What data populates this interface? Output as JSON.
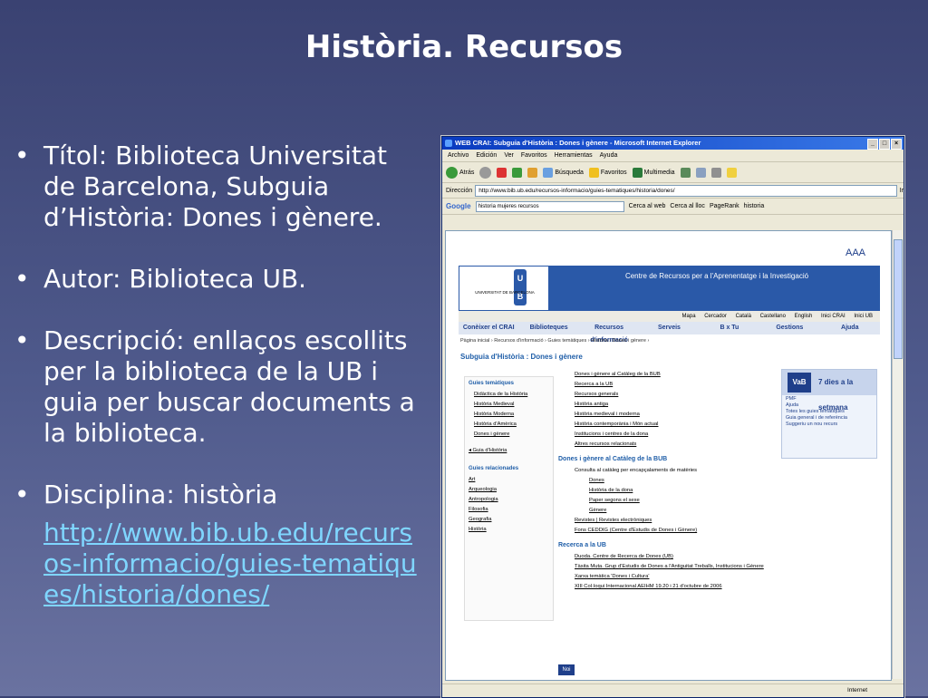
{
  "slide": {
    "title": "Història. Recursos",
    "bullets": [
      {
        "text": "Títol: Biblioteca Universitat de Barcelona, Subguia d’Història: Dones i gènere."
      },
      {
        "text": "Autor: Biblioteca UB."
      },
      {
        "text": "Descripció: enllaços escollits per la biblioteca de la UB i guia per buscar documents a la biblioteca."
      },
      {
        "text": "Disciplina: història",
        "url": "http://www.bib.ub.edu/recursos-informacio/guies-tematiques/historia/dones/"
      }
    ]
  },
  "browser": {
    "window_title": "WEB CRAI: Subguia d'Història : Dones i gènere - Microsoft Internet Explorer",
    "menu": [
      "Archivo",
      "Edición",
      "Ver",
      "Favoritos",
      "Herramientas",
      "Ayuda"
    ],
    "toolbar": {
      "back": "Atrás",
      "search": "Búsqueda",
      "favorites": "Favoritos",
      "media": "Multimedia"
    },
    "address_label": "Dirección",
    "address": "http://www.bib.ub.edu/recursos-informacio/guies-tematiques/historia/dones/",
    "go_label": "Ir",
    "google": {
      "logo": "Google",
      "query": "historia mujeres recursos",
      "web": "Cerca al web",
      "site": "Cerca al lloc",
      "pagerank": "PageRank",
      "hist": "historia"
    },
    "status": "Internet"
  },
  "page": {
    "font_size": "AAA",
    "university": "UNIVERSITAT DE BARCELONA",
    "crai_title": "Centre de Recursos per a l'Aprenentatge i la Investigació",
    "lang_links": [
      "Mapa",
      "Cercador",
      "Català",
      "Castellano",
      "English",
      "Inici CRAI",
      "Inici UB"
    ],
    "nav": [
      "Conèixer el CRAI",
      "Biblioteques",
      "Recursos d'informació",
      "Serveis",
      "B x Tu",
      "Gestions",
      "Ajuda"
    ],
    "breadcrumb": "Pàgina inicial › Recursos d'informació › Guies temàtiques › Història › Dones i gènere ›",
    "heading": "Subguia d'Història : Dones i gènere",
    "sidebar": {
      "title": "Guies temàtiques",
      "items": [
        "Didàctica de la Història",
        "Història Medieval",
        "Història Moderna",
        "Història d'Amèrica",
        "Dones i gènere"
      ],
      "back": "◂ Guia d'Història",
      "related_title": "Guies relacionades",
      "related": [
        "Art",
        "Arqueologia",
        "Antropologia",
        "Filosofia",
        "Geografia",
        "Història"
      ]
    },
    "links": [
      "Dones i gènere al Catàleg de la BUB",
      "Recerca a la UB",
      "Recursos generals",
      "Història antiga",
      "Història medieval i moderna",
      "Història contemporània i Món actual",
      "Institucions i centres de la dona",
      "Altres recursos relacionats"
    ],
    "sec1": "Dones i gènere al Catàleg de la BUB",
    "sec1_intro": "Consulta al catàleg per encapçalaments de matèries",
    "sec1_items": [
      "Dones",
      "Història de la dona",
      "Paper segons el sexe",
      "Gènere"
    ],
    "sec1_more": [
      "Revistes | Revistes electròniques",
      "Fons CEDDIG (Centre d'Estudis de Dones i Gènere)"
    ],
    "sec2": "Recerca a la UB",
    "sec2_items": [
      "Duoda. Centre de Recerca de Dones (UB)",
      "Tàsita Muta. Grup d'Estudis de Dones a l'Antiguitat Treballs, Institucions i Gènere",
      "Xarxa temàtica 'Dones i Cultura'",
      "XIII Col·loqui Internacional AEIHM 19.20 i 21 d'octubre de 2006"
    ],
    "box": {
      "logo": "VaB",
      "title": "7 dies a la setmana",
      "items": [
        "PMF",
        "Ajuda",
        "Totes les guies temàtiques",
        "Guia general i de referència",
        "Suggeriu un nou recurs"
      ]
    },
    "noi": "Noi"
  }
}
